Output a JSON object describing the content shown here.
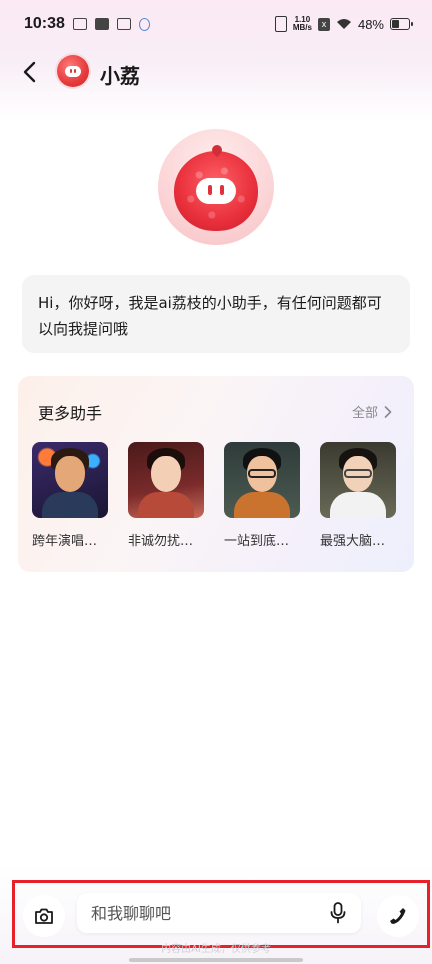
{
  "status_bar": {
    "time": "10:38",
    "speed_value": "1.10",
    "speed_unit": "MB/s",
    "battery": "48%",
    "battery_level": 0.48
  },
  "header": {
    "title": "小荔",
    "back_icon": "chevron-left-icon"
  },
  "greeting": {
    "text": "Hi，你好呀，我是ai荔枝的小助手，有任何问题都可以向我提问哦"
  },
  "more_assistants": {
    "title": "更多助手",
    "all_label": "全部",
    "items": [
      {
        "name": "跨年演唱…"
      },
      {
        "name": "非诚勿扰…"
      },
      {
        "name": "一站到底…"
      },
      {
        "name": "最强大脑…"
      }
    ]
  },
  "input_bar": {
    "placeholder": "和我聊聊吧"
  },
  "footer": {
    "disclaimer": "内容由AI生成，仅供参考"
  },
  "colors": {
    "accent_red": "#e8202a",
    "lychee_red": "#e8303b"
  }
}
